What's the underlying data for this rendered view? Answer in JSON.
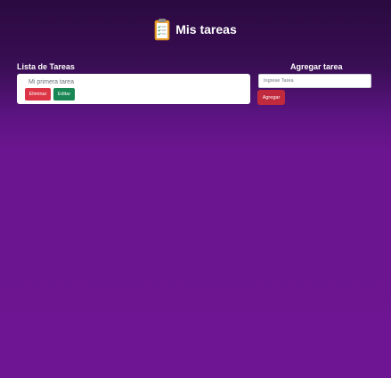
{
  "header": {
    "icon": "clipboard-checklist-icon",
    "title": "Mis tareas"
  },
  "task_list": {
    "title": "Lista de Tareas",
    "items": [
      {
        "text": "Mi primera tarea",
        "delete_label": "Eliminar",
        "edit_label": "Editar"
      }
    ]
  },
  "add_task": {
    "title": "Agregar tarea",
    "input_placeholder": "Ingrese Tarea",
    "input_value": "",
    "button_label": "Agregar"
  },
  "colors": {
    "delete": "#dc3545",
    "edit": "#198754",
    "add": "#c12a3c",
    "background_top": "#2a0a3f",
    "background_bottom": "#6d1592"
  }
}
